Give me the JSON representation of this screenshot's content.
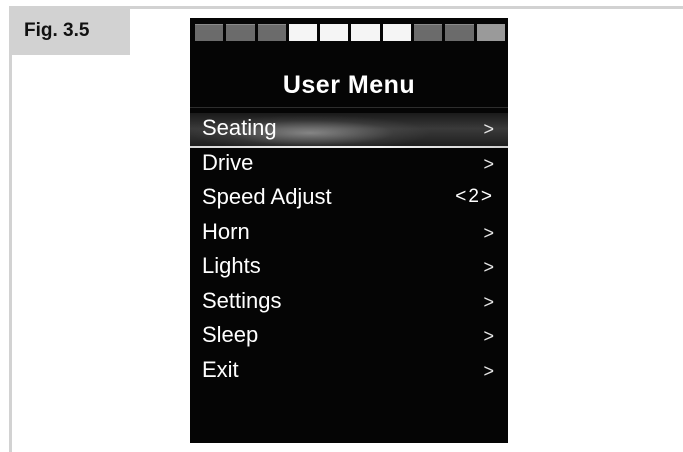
{
  "figure": {
    "label": "Fig. 3.5"
  },
  "battery": {
    "segments": [
      "dim",
      "dim",
      "dim",
      "lit",
      "lit",
      "lit",
      "lit",
      "dim",
      "dim",
      "end"
    ]
  },
  "menu": {
    "title": "User Menu",
    "items": [
      {
        "label": "Seating",
        "indicator": ">",
        "selected": true
      },
      {
        "label": "Drive",
        "indicator": ">"
      },
      {
        "label": "Speed Adjust",
        "indicator": "<2>"
      },
      {
        "label": "Horn",
        "indicator": ">"
      },
      {
        "label": "Lights",
        "indicator": ">"
      },
      {
        "label": "Settings",
        "indicator": ">"
      },
      {
        "label": "Sleep",
        "indicator": ">"
      },
      {
        "label": "Exit",
        "indicator": ">"
      }
    ]
  },
  "colors": {
    "screen_background": "#050505",
    "text": "#ffffff",
    "frame": "#d2d2d2"
  }
}
